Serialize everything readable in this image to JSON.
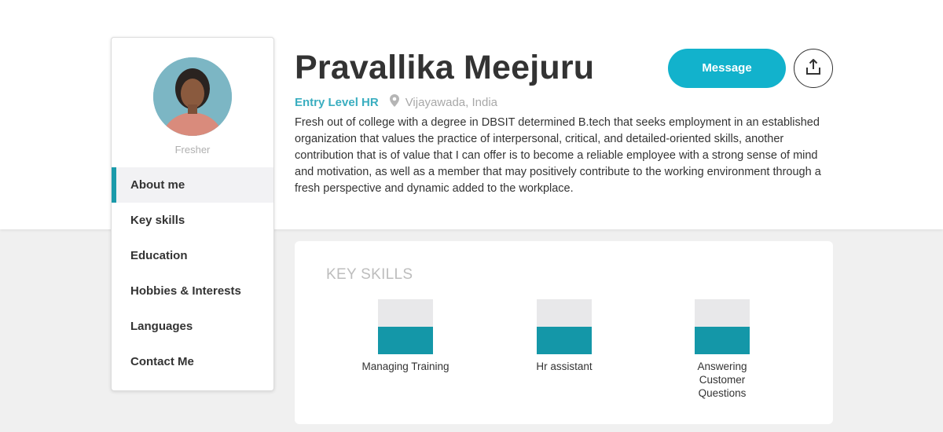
{
  "profile": {
    "name": "Pravallika Meejuru",
    "role": "Entry Level HR",
    "location": "Vijayawada, India",
    "status": "Fresher",
    "bio": "Fresh out of college with a degree in DBSIT determined B.tech that seeks employment in an established organization that values the practice of interpersonal, critical, and detailed-oriented skills, another contribution that is of value that I can offer is to become a reliable employee with a strong sense of mind and motivation, as well as a member that may positively contribute to the working environment through a fresh perspective and dynamic added to the workplace."
  },
  "actions": {
    "message_label": "Message",
    "share_icon": "share-upload-icon"
  },
  "sidebar": {
    "items": [
      {
        "label": "About me",
        "active": true
      },
      {
        "label": "Key skills"
      },
      {
        "label": "Education"
      },
      {
        "label": "Hobbies & Interests"
      },
      {
        "label": "Languages"
      },
      {
        "label": "Contact Me"
      }
    ]
  },
  "key_skills": {
    "title": "KEY SKILLS",
    "items": [
      {
        "label": "Managing Training",
        "level": 0.5
      },
      {
        "label": "Hr assistant",
        "level": 0.5
      },
      {
        "label": "Answering Customer Questions",
        "level": 0.5
      }
    ]
  },
  "colors": {
    "accent": "#12b2cc",
    "skill_fill": "#1497a8",
    "role_text": "#3aaec0"
  }
}
